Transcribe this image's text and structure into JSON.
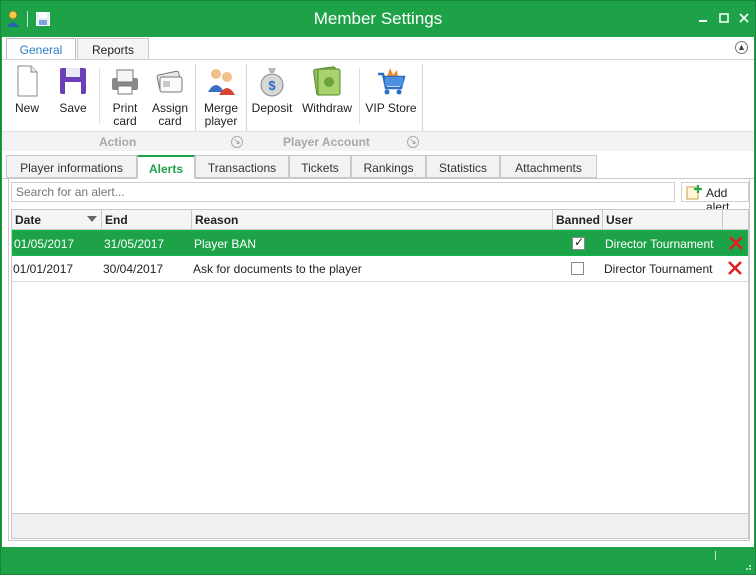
{
  "window": {
    "title": "Member Settings",
    "accent_color": "#1ea248"
  },
  "ribbon": {
    "tabs": [
      {
        "label": "General",
        "active": true
      },
      {
        "label": "Reports",
        "active": false
      }
    ],
    "buttons": [
      {
        "label_line1": "New",
        "label_line2": "",
        "icon": "new-document-icon"
      },
      {
        "label_line1": "Save",
        "label_line2": "",
        "icon": "save-disk-icon"
      },
      {
        "label_line1": "Print",
        "label_line2": "card",
        "icon": "print-card-icon"
      },
      {
        "label_line1": "Assign",
        "label_line2": "card",
        "icon": "assign-card-icon"
      },
      {
        "label_line1": "Merge",
        "label_line2": "player",
        "icon": "merge-player-icon"
      },
      {
        "label_line1": "Deposit",
        "label_line2": "",
        "icon": "money-bag-icon"
      },
      {
        "label_line1": "Withdraw",
        "label_line2": "",
        "icon": "banknotes-icon"
      },
      {
        "label_line1": "VIP Store",
        "label_line2": "",
        "icon": "shopping-cart-icon"
      }
    ],
    "groups": [
      {
        "label": "Action"
      },
      {
        "label": "Player Account"
      }
    ]
  },
  "content_tabs": [
    {
      "label": "Player informations",
      "active": false
    },
    {
      "label": "Alerts",
      "active": true
    },
    {
      "label": "Transactions",
      "active": false
    },
    {
      "label": "Tickets",
      "active": false
    },
    {
      "label": "Rankings",
      "active": false
    },
    {
      "label": "Statistics",
      "active": false
    },
    {
      "label": "Attachments",
      "active": false
    }
  ],
  "alerts": {
    "search_placeholder": "Search for an alert...",
    "add_label": "Add alert",
    "columns": [
      "Date",
      "End",
      "Reason",
      "Banned",
      "User"
    ],
    "rows": [
      {
        "date": "01/05/2017",
        "end": "31/05/2017",
        "reason": "Player BAN",
        "banned": true,
        "user": "Director Tournament",
        "selected": true
      },
      {
        "date": "01/01/2017",
        "end": "30/04/2017",
        "reason": "Ask for documents to the player",
        "banned": false,
        "user": "Director Tournament",
        "selected": false
      }
    ]
  }
}
